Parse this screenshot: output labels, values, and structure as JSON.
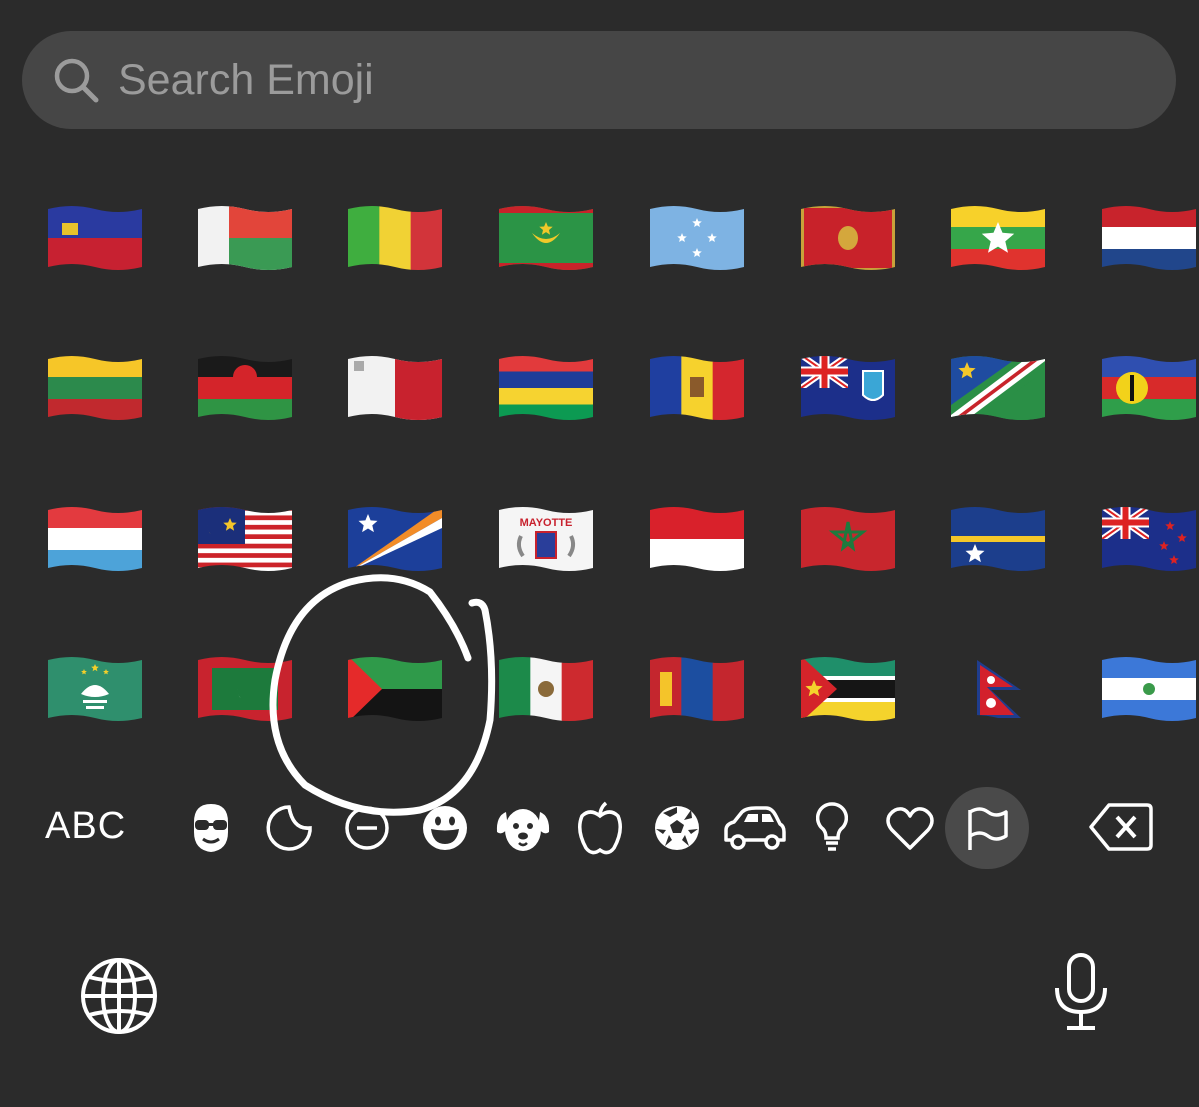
{
  "search": {
    "placeholder": "Search Emoji",
    "icon": "search-icon"
  },
  "flags": [
    [
      "Liechtenstein",
      "Madagascar",
      "Mali",
      "Mauritania",
      "Micronesia",
      "Montenegro",
      "Myanmar (Burma)",
      "Netherlands"
    ],
    [
      "Lithuania",
      "Malawi",
      "Malta",
      "Mauritius",
      "Moldova",
      "Montserrat",
      "Namibia",
      "New Caledonia"
    ],
    [
      "Luxembourg",
      "Malaysia",
      "Marshall Islands",
      "Mayotte",
      "Monaco",
      "Morocco",
      "Nauru",
      "New Zealand"
    ],
    [
      "Macao",
      "Maldives",
      "Martinique",
      "Mexico",
      "Mongolia",
      "Mozambique",
      "Nepal",
      "Nicaragua"
    ]
  ],
  "mayotte_text": "MAYOTTE",
  "categories": {
    "abc_label": "ABC",
    "icons": [
      "memoji-icon",
      "sticker-icon",
      "recent-icon",
      "smileys-icon",
      "animals-icon",
      "food-icon",
      "activity-icon",
      "travel-icon",
      "objects-icon",
      "symbols-icon",
      "flags-icon"
    ],
    "active": "flags-icon"
  },
  "bottom": {
    "left": "globe-icon",
    "right": "microphone-icon"
  },
  "annotation": "hand-drawn-circle",
  "colors": {
    "background": "#2b2b2b",
    "search_bg": "#464646",
    "placeholder": "#9b9b9b",
    "active_bg": "#4a4a4a"
  }
}
